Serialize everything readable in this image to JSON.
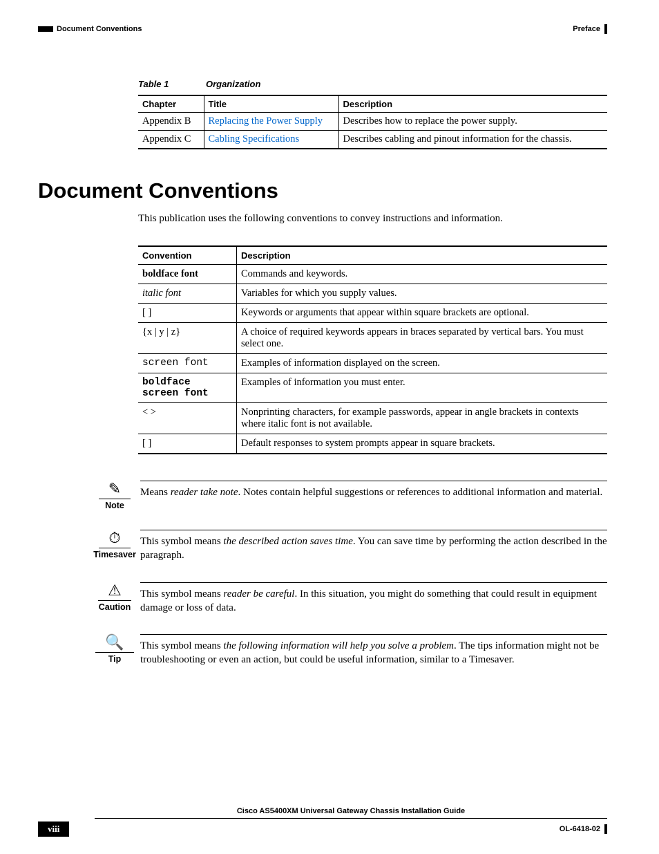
{
  "header": {
    "left_section": "Document Conventions",
    "right_chapter": "Preface"
  },
  "table1": {
    "caption_label": "Table 1",
    "caption_title": "Organization",
    "headers": {
      "c1": "Chapter",
      "c2": "Title",
      "c3": "Description"
    },
    "rows": [
      {
        "chapter": "Appendix B",
        "title": "Replacing the Power Supply",
        "desc": "Describes how to replace the power supply."
      },
      {
        "chapter": "Appendix C",
        "title": "Cabling Specifications",
        "desc": "Describes cabling and pinout information for the chassis."
      }
    ]
  },
  "section": {
    "heading": "Document Conventions",
    "intro": "This publication uses the following conventions to convey instructions and information."
  },
  "conv_table": {
    "headers": {
      "c1": "Convention",
      "c2": "Description"
    },
    "rows": [
      {
        "conv": "boldface font",
        "style": "conv-bold",
        "desc": "Commands and keywords."
      },
      {
        "conv": "italic font",
        "style": "conv-italic",
        "desc": "Variables for which you supply values."
      },
      {
        "conv": "[     ]",
        "style": "",
        "desc": "Keywords or arguments that appear within square brackets are optional."
      },
      {
        "conv": "{x | y | z}",
        "style": "",
        "desc": "A choice of required keywords appears in braces separated by vertical bars. You must select one."
      },
      {
        "conv": "screen font",
        "style": "conv-mono",
        "desc": "Examples of information displayed on the screen."
      },
      {
        "conv": "boldface screen font",
        "style": "conv-mono-bold",
        "desc": "Examples of information you must enter."
      },
      {
        "conv": "<   >",
        "style": "",
        "desc": "Nonprinting characters, for example passwords, appear in angle brackets in contexts where italic font is not available."
      },
      {
        "conv": "[   ]",
        "style": "",
        "desc": "Default responses to system prompts appear in square brackets."
      }
    ]
  },
  "callouts": {
    "note": {
      "label": "Note",
      "icon": "✎",
      "pre": "Means ",
      "em": "reader take note",
      "post": ". Notes contain helpful suggestions or references to additional information and material."
    },
    "timesaver": {
      "label": "Timesaver",
      "icon": "⏱",
      "pre": "This symbol means ",
      "em": "the described action saves time",
      "post": ". You can save time by performing the action described in the paragraph."
    },
    "caution": {
      "label": "Caution",
      "icon": "⚠",
      "pre": "This symbol means ",
      "em": "reader be careful",
      "post": ". In this situation, you might do something that could result in equipment damage or loss of data."
    },
    "tip": {
      "label": "Tip",
      "icon": "🔍",
      "pre": "This symbol means ",
      "em": "the following information will help you solve a problem",
      "post": ". The tips information might not be troubleshooting or even an action, but could be useful information, similar to a Timesaver."
    }
  },
  "footer": {
    "guide_title": "Cisco AS5400XM Universal Gateway Chassis Installation Guide",
    "page_number": "viii",
    "doc_id": "OL-6418-02"
  }
}
